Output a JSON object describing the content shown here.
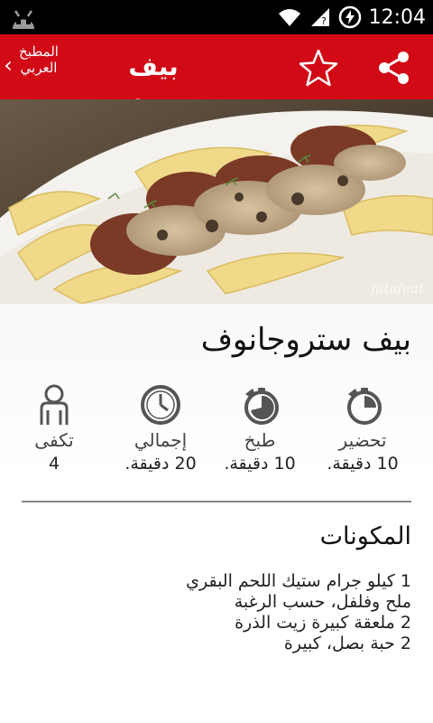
{
  "status_bar": {
    "time": "12:04"
  },
  "app_bar": {
    "logo_line1": "المطبخ",
    "logo_line2": "العربي",
    "title": "بيف ستروجانوف"
  },
  "hero": {
    "watermark": "fatafeat"
  },
  "recipe": {
    "title": "بيف ستروجانوف",
    "stats": [
      {
        "label": "تحضير",
        "value": "10 دقيقة."
      },
      {
        "label": "طبخ",
        "value": "10 دقيقة."
      },
      {
        "label": "إجمالي",
        "value": "20 دقيقة."
      },
      {
        "label": "تكفى",
        "value": "4"
      }
    ],
    "ingredients_title": "المكونات",
    "ingredients": [
      "1 كيلو جرام ستيك اللحم البقري",
      "ملح وفلفل، حسب الرغبة",
      "2 ملعقة كبيرة زيت الذرة",
      "2 حبة بصل، كبيرة"
    ]
  },
  "colors": {
    "accent": "#d10a16"
  }
}
